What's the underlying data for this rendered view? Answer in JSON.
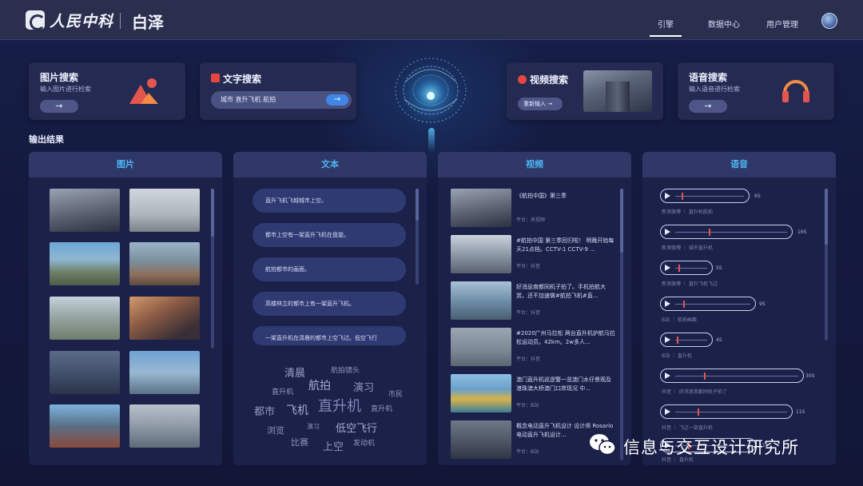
{
  "header": {
    "logo_text": "人民中科",
    "product_name": "白泽",
    "nav": [
      {
        "label": "引擎",
        "active": true
      },
      {
        "label": "数据中心",
        "active": false
      },
      {
        "label": "用户管理",
        "active": false
      }
    ]
  },
  "search": {
    "image": {
      "title": "图片搜索",
      "subtitle": "输入图片进行检索",
      "button": "→"
    },
    "text": {
      "title": "文字搜索",
      "input_value": "城市 直升飞机 航拍",
      "button": "→"
    },
    "video": {
      "title": "视频搜索",
      "button": "重新输入 →"
    },
    "voice": {
      "title": "语音搜索",
      "subtitle": "输入语音进行检索",
      "button": "→"
    }
  },
  "output": {
    "section_title": "输出结果",
    "panels": {
      "image": "图片",
      "text": "文本",
      "video": "视频",
      "voice": "语音"
    }
  },
  "text_results": [
    "直升飞机飞越城市上空。",
    "都市上空有一架直升飞机在盘旋。",
    "航拍都市的画面。",
    "高楼林立的都市上有一架直升飞机。",
    "一架直升机在清晨的都市上空飞过。低空飞行"
  ],
  "word_cloud": [
    "清晨",
    "航拍镜头",
    "直升机",
    "航拍",
    "演习",
    "市民",
    "都市",
    "飞机",
    "直升机",
    "直升机",
    "浏览",
    "演习",
    "低空飞行",
    "比赛",
    "上空",
    "发动机"
  ],
  "video_results": [
    {
      "title": "《航拍中国》第三季",
      "meta": "平台：央视频"
    },
    {
      "title": "#航拍中国 第三季回归啦！ 明晚开始每天21点档。CCTV-1 CCTV-9 ...",
      "meta": "平台：抖音"
    },
    {
      "title": "好消息南都同机子拍了。手机拍航大赏。还不加速做#航拍飞机#直...",
      "meta": "平台：抖音"
    },
    {
      "title": "#2020广州马拉松 两台直升机护航马拉松运动员。42km。2w多人...",
      "meta": "平台：抖音"
    },
    {
      "title": "澳门直升机巡逻警一览澳门水仔景观及港珠澳大桥澳门口岸现况 中...",
      "meta": "平台：B站"
    },
    {
      "title": "概念电动直升飞机设计 设计师 Rosario 电动直升飞机设计...",
      "meta": "平台：B站"
    }
  ],
  "voice_results": [
    {
      "duration": "6S",
      "meta": "新浪微博 ｜ 直升机航拍"
    },
    {
      "duration": "16S",
      "meta": "新浪微博 ｜ 城市直升机"
    },
    {
      "duration": "5S",
      "meta": "新浪微博 ｜ 直升飞机飞过"
    },
    {
      "duration": "9S",
      "meta": "B站 ｜ 航拍画面"
    },
    {
      "duration": "4S",
      "meta": "B站 ｜ 直升机"
    },
    {
      "duration": "30S",
      "meta": "抖音 ｜ 好消息南都同机子拍了"
    },
    {
      "duration": "11S",
      "meta": "抖音 ｜ 飞过一架直升机"
    },
    {
      "duration": "11S",
      "meta": "抖音 ｜ 直升机"
    }
  ],
  "watermark": "信息与交互设计研究所",
  "colors": {
    "accent": "#3f86e6",
    "panel_title": "#4fb5f5",
    "badge_red": "#e4473f"
  }
}
